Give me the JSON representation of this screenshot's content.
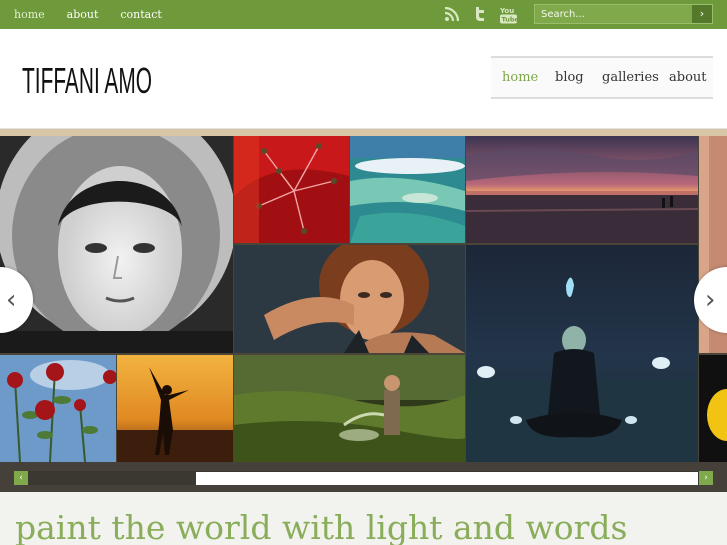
{
  "topbar": {
    "links": [
      "home",
      "about",
      "contact"
    ],
    "social_icons": [
      "rss-icon",
      "twitter-icon",
      "youtube-icon"
    ],
    "search": {
      "placeholder": "Search...",
      "button_icon": "chevron-right-icon"
    }
  },
  "header": {
    "logo_text": "Tiffani Amo",
    "nav": [
      "home",
      "blog",
      "galleries",
      "about"
    ],
    "active_nav": "home"
  },
  "slider": {
    "photos": [
      "portrait-girl-fur-hood-bw",
      "red-flower-closeup",
      "aerial-lagoon",
      "sunset-beach",
      "woman-portrait-hand-hair",
      "meditating-figure-night",
      "red-roses-sky",
      "silhouette-sunset",
      "man-watering-garden",
      "yellow-flower-edge"
    ],
    "prev_icon": "chevron-left-icon",
    "next_icon": "chevron-right-icon"
  },
  "tagline": "paint the world with light and words",
  "colors": {
    "accent": "#6f9a3b",
    "active_nav": "#7ea74a",
    "tagline": "#89ad5a"
  }
}
